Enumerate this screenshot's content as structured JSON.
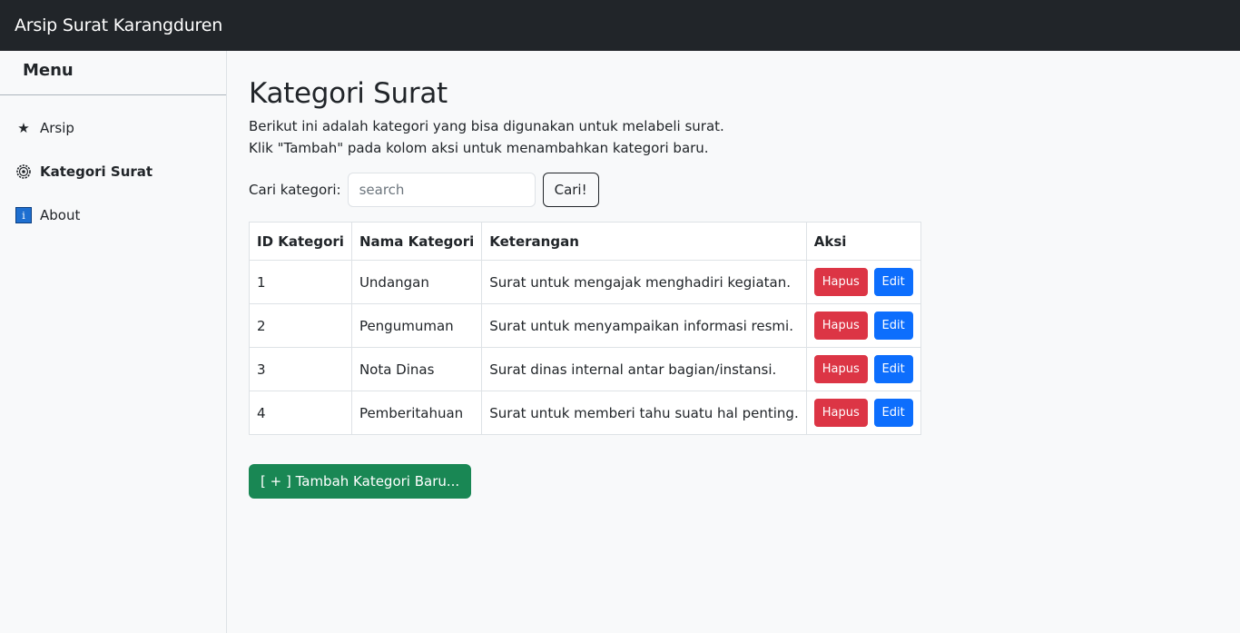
{
  "navbar": {
    "brand": "Arsip Surat Karangduren"
  },
  "sidebar": {
    "title": "Menu",
    "items": [
      {
        "label": "Arsip",
        "icon": "star-icon"
      },
      {
        "label": "Kategori Surat",
        "icon": "gear-icon",
        "active": true
      },
      {
        "label": "About",
        "icon": "info-icon"
      }
    ]
  },
  "main": {
    "title": "Kategori Surat",
    "desc_line1": "Berikut ini adalah kategori yang bisa digunakan untuk melabeli surat.",
    "desc_line2": "Klik \"Tambah\" pada kolom aksi untuk menambahkan kategori baru.",
    "search": {
      "label": "Cari kategori:",
      "placeholder": "search",
      "value": "",
      "button": "Cari!"
    },
    "table": {
      "headers": [
        "ID Kategori",
        "Nama Kategori",
        "Keterangan",
        "Aksi"
      ],
      "rows": [
        {
          "id": "1",
          "nama": "Undangan",
          "keterangan": "Surat untuk mengajak menghadiri kegiatan."
        },
        {
          "id": "2",
          "nama": "Pengumuman",
          "keterangan": "Surat untuk menyampaikan informasi resmi."
        },
        {
          "id": "3",
          "nama": "Nota Dinas",
          "keterangan": "Surat dinas internal antar bagian/instansi."
        },
        {
          "id": "4",
          "nama": "Pemberitahuan",
          "keterangan": "Surat untuk memberi tahu suatu hal penting."
        }
      ],
      "delete_label": "Hapus",
      "edit_label": "Edit"
    },
    "add_button": "[ + ] Tambah Kategori Baru..."
  },
  "colors": {
    "navbar_bg": "#212529",
    "danger": "#dc3545",
    "primary": "#0d6efd",
    "success": "#198754"
  }
}
